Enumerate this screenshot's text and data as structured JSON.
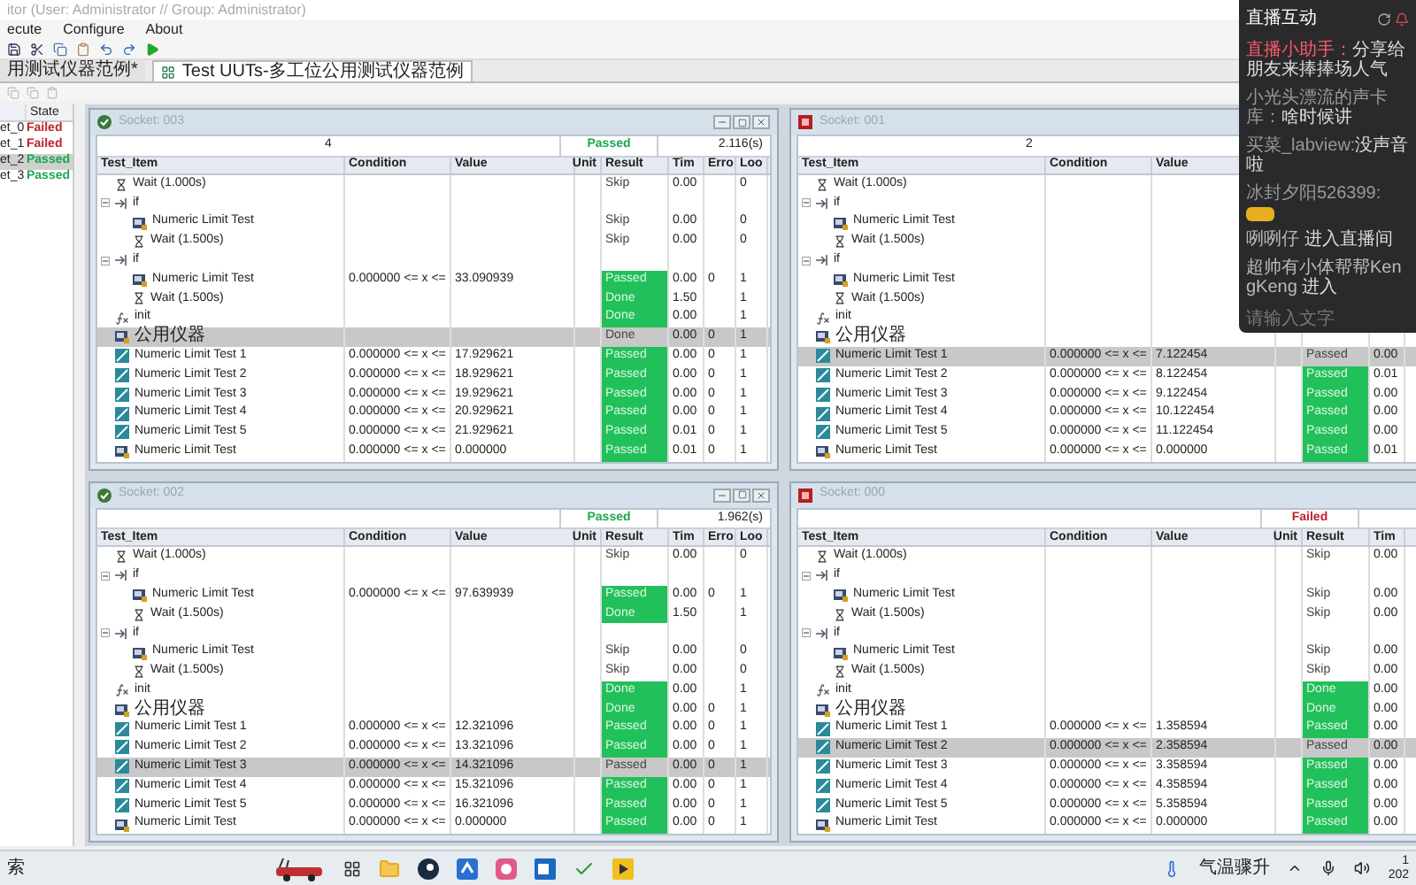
{
  "window": {
    "title": "itor (User: Administrator // Group: Administrator)"
  },
  "menu": [
    "ecute",
    "Configure",
    "About"
  ],
  "tabs": [
    {
      "label": "用测试仪器范例*",
      "selected": false
    },
    {
      "label": "Test UUTs-多工位公用测试仪器范例",
      "selected": true
    }
  ],
  "sidebar": {
    "header": "State",
    "rows": [
      {
        "name": "et_0",
        "state": "Failed",
        "passed": false,
        "selected": false
      },
      {
        "name": "et_1",
        "state": "Failed",
        "passed": false,
        "selected": false
      },
      {
        "name": "et_2",
        "state": "Passed",
        "passed": true,
        "selected": true
      },
      {
        "name": "et_3",
        "state": "Passed",
        "passed": true,
        "selected": false
      }
    ]
  },
  "panels": [
    {
      "title": "Socket: 003",
      "passed": true,
      "window_buttons": true,
      "count": "4",
      "status_text": "Passed",
      "elapsed": "2.116(s)",
      "columns": [
        "Test_Item",
        "Condition",
        "Value",
        "Unit",
        "Result",
        "Tim",
        "Erro",
        "Loo"
      ],
      "rows": [
        {
          "kind": "wait",
          "name": "Wait (1.000s)",
          "result": "Skip",
          "highlighted": false,
          "selected": false,
          "time": "0.00",
          "loop": "0"
        },
        {
          "kind": "if",
          "name": "if",
          "selected": false,
          "children": [
            {
              "kind": "numeric",
              "name": "Numeric Limit Test",
              "result": "Skip",
              "highlighted": false,
              "selected": false,
              "time": "0.00",
              "loop": "0"
            },
            {
              "kind": "wait",
              "name": "Wait (1.500s)",
              "result": "Skip",
              "highlighted": false,
              "selected": false,
              "time": "0.00",
              "loop": "0"
            }
          ]
        },
        {
          "kind": "if",
          "name": "if",
          "selected": false,
          "children": [
            {
              "kind": "numeric",
              "name": "Numeric Limit Test",
              "condition": "0.000000 <= x <=",
              "value": "33.090939",
              "result": "Passed",
              "highlighted": true,
              "selected": false,
              "time": "0.00",
              "error": "0",
              "loop": "1"
            },
            {
              "kind": "wait",
              "name": "Wait (1.500s)",
              "result": "Done",
              "highlighted": true,
              "selected": false,
              "time": "1.50",
              "loop": "1"
            }
          ]
        },
        {
          "kind": "func",
          "name": "init",
          "result": "Done",
          "highlighted": true,
          "selected": false,
          "time": "0.00",
          "loop": "1"
        },
        {
          "kind": "numeric",
          "name": "公用仪器",
          "result": "Done",
          "highlighted": false,
          "selected": true,
          "time": "0.00",
          "error": "0",
          "loop": "1"
        },
        {
          "kind": "multi",
          "name": "Numeric Limit Test 1",
          "condition": "0.000000 <= x <=",
          "value": "17.929621",
          "result": "Passed",
          "highlighted": true,
          "selected": false,
          "time": "0.00",
          "error": "0",
          "loop": "1"
        },
        {
          "kind": "multi",
          "name": "Numeric Limit Test 2",
          "condition": "0.000000 <= x <=",
          "value": "18.929621",
          "result": "Passed",
          "highlighted": true,
          "selected": false,
          "time": "0.00",
          "error": "0",
          "loop": "1"
        },
        {
          "kind": "multi",
          "name": "Numeric Limit Test 3",
          "condition": "0.000000 <= x <=",
          "value": "19.929621",
          "result": "Passed",
          "highlighted": true,
          "selected": false,
          "time": "0.00",
          "error": "0",
          "loop": "1"
        },
        {
          "kind": "multi",
          "name": "Numeric Limit Test 4",
          "condition": "0.000000 <= x <=",
          "value": "20.929621",
          "result": "Passed",
          "highlighted": true,
          "selected": false,
          "time": "0.00",
          "error": "0",
          "loop": "1"
        },
        {
          "kind": "multi",
          "name": "Numeric Limit Test 5",
          "condition": "0.000000 <= x <=",
          "value": "21.929621",
          "result": "Passed",
          "highlighted": true,
          "selected": false,
          "time": "0.01",
          "error": "0",
          "loop": "1"
        },
        {
          "kind": "numeric",
          "name": "Numeric Limit Test",
          "condition": "0.000000 <= x <=",
          "value": "0.000000",
          "result": "Passed",
          "highlighted": true,
          "selected": false,
          "time": "0.01",
          "error": "0",
          "loop": "1"
        }
      ]
    },
    {
      "title": "Socket: 001",
      "passed": false,
      "window_buttons": false,
      "count": "2",
      "columns": [
        "Test_Item",
        "Condition",
        "Value"
      ],
      "rows": [
        {
          "kind": "wait",
          "name": "Wait (1.000s)",
          "selected": false
        },
        {
          "kind": "if",
          "name": "if",
          "selected": false,
          "children": [
            {
              "kind": "numeric",
              "name": "Numeric Limit Test",
              "selected": false
            },
            {
              "kind": "wait",
              "name": "Wait (1.500s)",
              "selected": false
            }
          ]
        },
        {
          "kind": "if",
          "name": "if",
          "selected": false,
          "children": [
            {
              "kind": "numeric",
              "name": "Numeric Limit Test",
              "selected": false
            },
            {
              "kind": "wait",
              "name": "Wait (1.500s)",
              "selected": false
            }
          ]
        },
        {
          "kind": "func",
          "name": "init",
          "selected": false
        },
        {
          "kind": "numeric",
          "name": "公用仪器",
          "selected": false
        },
        {
          "kind": "multi",
          "name": "Numeric Limit Test 1",
          "condition": "0.000000 <= x <=",
          "value": "7.122454",
          "result": "Passed",
          "highlighted": false,
          "selected": true,
          "time": "0.00"
        },
        {
          "kind": "multi",
          "name": "Numeric Limit Test 2",
          "condition": "0.000000 <= x <=",
          "value": "8.122454",
          "result": "Passed",
          "highlighted": true,
          "selected": false,
          "time": "0.01"
        },
        {
          "kind": "multi",
          "name": "Numeric Limit Test 3",
          "condition": "0.000000 <= x <=",
          "value": "9.122454",
          "result": "Passed",
          "highlighted": true,
          "selected": false,
          "time": "0.00"
        },
        {
          "kind": "multi",
          "name": "Numeric Limit Test 4",
          "condition": "0.000000 <= x <=",
          "value": "10.122454",
          "result": "Passed",
          "highlighted": true,
          "selected": false,
          "time": "0.00"
        },
        {
          "kind": "multi",
          "name": "Numeric Limit Test 5",
          "condition": "0.000000 <= x <=",
          "value": "11.122454",
          "result": "Passed",
          "highlighted": true,
          "selected": false,
          "time": "0.00"
        },
        {
          "kind": "numeric",
          "name": "Numeric Limit Test",
          "condition": "0.000000 <= x <=",
          "value": "0.000000",
          "result": "Passed",
          "highlighted": true,
          "selected": false,
          "time": "0.01"
        }
      ]
    },
    {
      "title": "Socket: 002",
      "passed": true,
      "window_buttons": true,
      "status_text": "Passed",
      "elapsed": "1.962(s)",
      "columns": [
        "Test_Item",
        "Condition",
        "Value",
        "Unit",
        "Result",
        "Tim",
        "Erro",
        "Loo"
      ],
      "rows": [
        {
          "kind": "wait",
          "name": "Wait (1.000s)",
          "result": "Skip",
          "highlighted": false,
          "selected": false,
          "time": "0.00",
          "loop": "0"
        },
        {
          "kind": "if",
          "name": "if",
          "selected": false,
          "children": [
            {
              "kind": "numeric",
              "name": "Numeric Limit Test",
              "condition": "0.000000 <= x <=",
              "value": "97.639939",
              "result": "Passed",
              "highlighted": true,
              "selected": false,
              "time": "0.00",
              "error": "0",
              "loop": "1"
            },
            {
              "kind": "wait",
              "name": "Wait (1.500s)",
              "result": "Done",
              "highlighted": true,
              "selected": false,
              "time": "1.50",
              "loop": "1"
            }
          ]
        },
        {
          "kind": "if",
          "name": "if",
          "selected": false,
          "children": [
            {
              "kind": "numeric",
              "name": "Numeric Limit Test",
              "result": "Skip",
              "highlighted": false,
              "selected": false,
              "time": "0.00",
              "loop": "0"
            },
            {
              "kind": "wait",
              "name": "Wait (1.500s)",
              "result": "Skip",
              "highlighted": false,
              "selected": false,
              "time": "0.00",
              "loop": "0"
            }
          ]
        },
        {
          "kind": "func",
          "name": "init",
          "result": "Done",
          "highlighted": true,
          "selected": false,
          "time": "0.00",
          "loop": "1"
        },
        {
          "kind": "numeric",
          "name": "公用仪器",
          "result": "Done",
          "highlighted": true,
          "selected": false,
          "time": "0.00",
          "error": "0",
          "loop": "1"
        },
        {
          "kind": "multi",
          "name": "Numeric Limit Test 1",
          "condition": "0.000000 <= x <=",
          "value": "12.321096",
          "result": "Passed",
          "highlighted": true,
          "selected": false,
          "time": "0.00",
          "error": "0",
          "loop": "1"
        },
        {
          "kind": "multi",
          "name": "Numeric Limit Test 2",
          "condition": "0.000000 <= x <=",
          "value": "13.321096",
          "result": "Passed",
          "highlighted": true,
          "selected": false,
          "time": "0.00",
          "error": "0",
          "loop": "1"
        },
        {
          "kind": "multi",
          "name": "Numeric Limit Test 3",
          "condition": "0.000000 <= x <=",
          "value": "14.321096",
          "result": "Passed",
          "highlighted": false,
          "selected": true,
          "time": "0.00",
          "error": "0",
          "loop": "1"
        },
        {
          "kind": "multi",
          "name": "Numeric Limit Test 4",
          "condition": "0.000000 <= x <=",
          "value": "15.321096",
          "result": "Passed",
          "highlighted": true,
          "selected": false,
          "time": "0.00",
          "error": "0",
          "loop": "1"
        },
        {
          "kind": "multi",
          "name": "Numeric Limit Test 5",
          "condition": "0.000000 <= x <=",
          "value": "16.321096",
          "result": "Passed",
          "highlighted": true,
          "selected": false,
          "time": "0.00",
          "error": "0",
          "loop": "1"
        },
        {
          "kind": "numeric",
          "name": "Numeric Limit Test",
          "condition": "0.000000 <= x <=",
          "value": "0.000000",
          "result": "Passed",
          "highlighted": true,
          "selected": false,
          "time": "0.00",
          "error": "0",
          "loop": "1"
        }
      ]
    },
    {
      "title": "Socket: 000",
      "passed": false,
      "window_buttons": false,
      "status_text": "Failed",
      "columns": [
        "Test_Item",
        "Condition",
        "Value",
        "Unit",
        "Result",
        "Tim"
      ],
      "rows": [
        {
          "kind": "wait",
          "name": "Wait (1.000s)",
          "result": "Skip",
          "highlighted": false,
          "selected": false,
          "time": "0.00"
        },
        {
          "kind": "if",
          "name": "if",
          "selected": false,
          "children": [
            {
              "kind": "numeric",
              "name": "Numeric Limit Test",
              "result": "Skip",
              "highlighted": false,
              "selected": false,
              "time": "0.00"
            },
            {
              "kind": "wait",
              "name": "Wait (1.500s)",
              "result": "Skip",
              "highlighted": false,
              "selected": false,
              "time": "0.00"
            }
          ]
        },
        {
          "kind": "if",
          "name": "if",
          "selected": false,
          "children": [
            {
              "kind": "numeric",
              "name": "Numeric Limit Test",
              "result": "Skip",
              "highlighted": false,
              "selected": false,
              "time": "0.00"
            },
            {
              "kind": "wait",
              "name": "Wait (1.500s)",
              "result": "Skip",
              "highlighted": false,
              "selected": false,
              "time": "0.00"
            }
          ]
        },
        {
          "kind": "func",
          "name": "init",
          "result": "Done",
          "highlighted": true,
          "selected": false,
          "time": "0.00"
        },
        {
          "kind": "numeric",
          "name": "公用仪器",
          "result": "Done",
          "highlighted": true,
          "selected": false,
          "time": "0.00"
        },
        {
          "kind": "multi",
          "name": "Numeric Limit Test 1",
          "condition": "0.000000 <= x <=",
          "value": "1.358594",
          "result": "Passed",
          "highlighted": true,
          "selected": false,
          "time": "0.00"
        },
        {
          "kind": "multi",
          "name": "Numeric Limit Test 2",
          "condition": "0.000000 <= x <=",
          "value": "2.358594",
          "result": "Passed",
          "highlighted": false,
          "selected": true,
          "time": "0.00"
        },
        {
          "kind": "multi",
          "name": "Numeric Limit Test 3",
          "condition": "0.000000 <= x <=",
          "value": "3.358594",
          "result": "Passed",
          "highlighted": true,
          "selected": false,
          "time": "0.00"
        },
        {
          "kind": "multi",
          "name": "Numeric Limit Test 4",
          "condition": "0.000000 <= x <=",
          "value": "4.358594",
          "result": "Passed",
          "highlighted": true,
          "selected": false,
          "time": "0.00"
        },
        {
          "kind": "multi",
          "name": "Numeric Limit Test 5",
          "condition": "0.000000 <= x <=",
          "value": "5.358594",
          "result": "Passed",
          "highlighted": true,
          "selected": false,
          "time": "0.00"
        },
        {
          "kind": "numeric",
          "name": "Numeric Limit Test",
          "condition": "0.000000 <= x <=",
          "value": "0.000000",
          "result": "Passed",
          "highlighted": true,
          "selected": false,
          "time": "0.00"
        }
      ]
    }
  ],
  "live_chat": {
    "title": "直播互动",
    "messages": [
      {
        "kind": "system",
        "user": "直播小助手：",
        "text": "分享给朋友来捧捧场人气"
      },
      {
        "kind": "chat",
        "user": "小光头漂流的声卡库：",
        "text": "啥时候讲"
      },
      {
        "kind": "chat",
        "user": "买菜_labview:",
        "text": "没声音啦"
      },
      {
        "kind": "chat",
        "user": "冰封夕阳526399:",
        "badge": true
      },
      {
        "kind": "enter",
        "user": "咧咧仔",
        "text": "进入直播间"
      },
      {
        "kind": "enter",
        "user": "超帅有小体帮帮KengKeng",
        "text": "进入"
      }
    ],
    "placeholder": "请输入文字"
  },
  "taskbar": {
    "search": "索",
    "weather": "气温骤升",
    "time": "1",
    "date": "202"
  }
}
